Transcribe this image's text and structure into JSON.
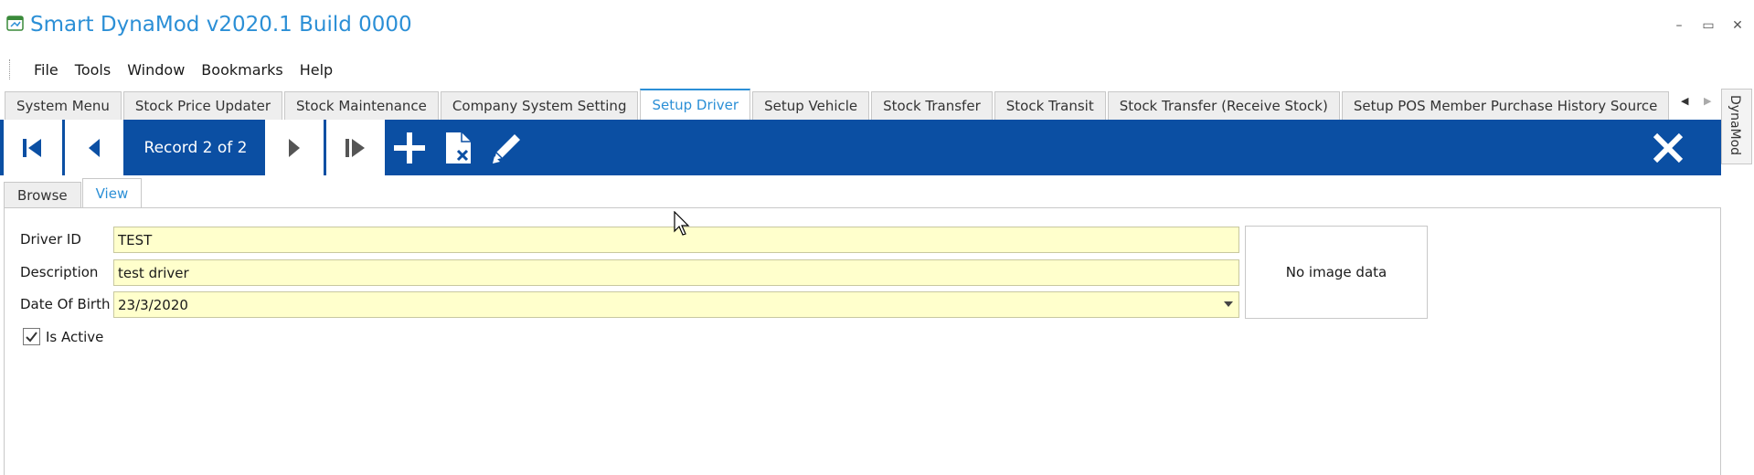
{
  "window": {
    "title": "Smart DynaMod v2020.1 Build 0000",
    "minimize_glyph": "–",
    "restore_glyph": "▭",
    "close_glyph": "✕"
  },
  "menu": {
    "items": [
      "File",
      "Tools",
      "Window",
      "Bookmarks",
      "Help"
    ]
  },
  "doc_tabs": {
    "items": [
      "System Menu",
      "Stock Price Updater",
      "Stock Maintenance",
      "Company System Setting",
      "Setup Driver",
      "Setup Vehicle",
      "Stock Transfer",
      "Stock Transit",
      "Stock Transfer (Receive Stock)",
      "Setup POS Member Purchase History Source"
    ],
    "active_index": 4,
    "scroll_left": "◀",
    "scroll_right": "▶"
  },
  "side_panel": {
    "label": "DynaMod"
  },
  "toolbar": {
    "record_label": "Record 2 of 2",
    "icons": [
      "first-record-icon",
      "previous-record-icon",
      "next-record-icon",
      "last-record-icon",
      "add-icon",
      "delete-icon",
      "edit-icon",
      "close-icon"
    ]
  },
  "inner_tabs": {
    "items": [
      "Browse",
      "View"
    ],
    "active_index": 1
  },
  "form": {
    "driver_id_label": "Driver ID",
    "driver_id_value": "TEST",
    "description_label": "Description",
    "description_value": "test driver",
    "dob_label": "Date Of Birth",
    "dob_value": "23/3/2020",
    "image_placeholder": "No image data",
    "is_active_label": "Is Active",
    "is_active_checked": true
  },
  "colors": {
    "accent": "#2b8fd6",
    "toolbar_bg": "#0b4fa3",
    "input_bg": "#ffffcc"
  }
}
